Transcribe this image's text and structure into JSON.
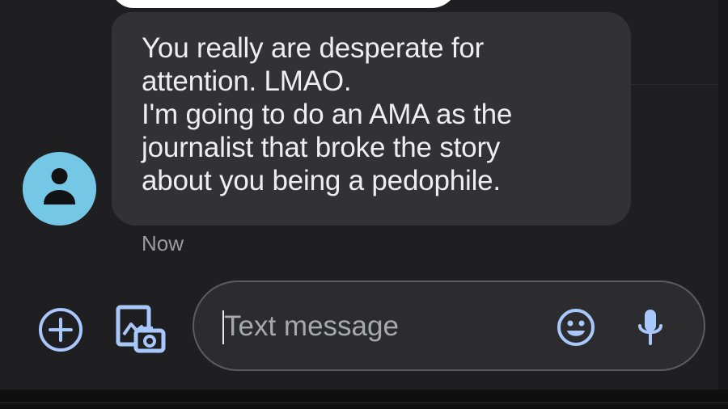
{
  "conversation": {
    "incoming_message": {
      "lines": [
        "You really are desperate for",
        "attention. LMAO.",
        "I'm going to do an AMA as the",
        "journalist that broke the story",
        "about you being a pedophile."
      ],
      "timestamp": "Now"
    },
    "contact": {
      "avatar_icon": "person-icon",
      "avatar_color": "#75c7e6"
    }
  },
  "composer": {
    "placeholder": "Text message",
    "add_icon": "add-circle-icon",
    "gallery_icon": "gallery-camera-icon",
    "emoji_icon": "emoji-icon",
    "mic_icon": "microphone-icon",
    "accent_color": "#a8c7fa"
  }
}
